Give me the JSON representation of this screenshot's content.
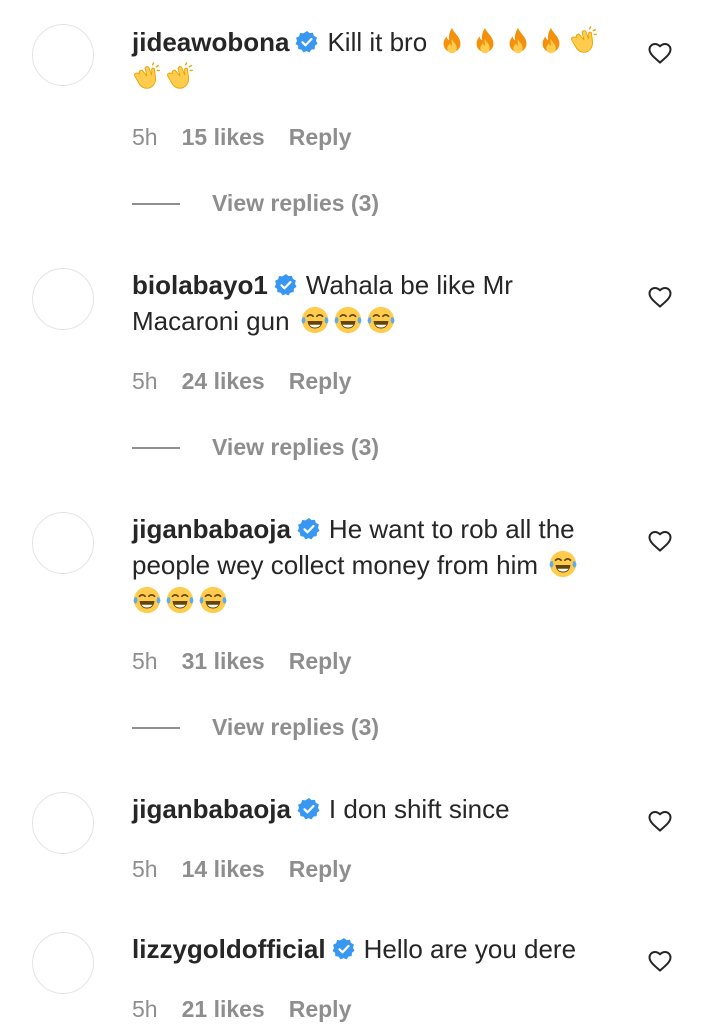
{
  "comments": [
    {
      "username": "jideawobona",
      "text": "Kill it bro",
      "emojis": [
        "fire-emoji",
        "fire-emoji",
        "fire-emoji",
        "fire-emoji",
        "clapping-hands-emoji",
        "clapping-hands-emoji",
        "clapping-hands-emoji"
      ],
      "time": "5h",
      "likes": "15 likes",
      "reply": "Reply",
      "view_replies": "View replies (3)"
    },
    {
      "username": "biolabayo1",
      "text": "Wahala be like Mr Macaroni gun",
      "emojis": [
        "tears-of-joy-emoji",
        "tears-of-joy-emoji",
        "tears-of-joy-emoji"
      ],
      "time": "5h",
      "likes": "24 likes",
      "reply": "Reply",
      "view_replies": "View replies (3)"
    },
    {
      "username": "jiganbabaoja",
      "text": "He want to rob all the people wey collect money from him",
      "emojis": [
        "tears-of-joy-emoji",
        "tears-of-joy-emoji",
        "tears-of-joy-emoji",
        "tears-of-joy-emoji"
      ],
      "time": "5h",
      "likes": "31 likes",
      "reply": "Reply",
      "view_replies": "View replies (3)"
    },
    {
      "username": "jiganbabaoja",
      "text": "I don shift since",
      "time": "5h",
      "likes": "14 likes",
      "reply": "Reply"
    },
    {
      "username": "lizzygoldofficial",
      "text": "Hello are you dere",
      "time": "5h",
      "likes": "21 likes",
      "reply": "Reply"
    }
  ],
  "colors": {
    "text": "#262626",
    "secondary": "#8e8e8e",
    "verified": "#3897f0",
    "fire": "#f4900c",
    "emoji_yellow": "#ffcc4d"
  },
  "icons": {
    "verified": "verified-badge-icon",
    "like": "heart-outline-icon"
  }
}
